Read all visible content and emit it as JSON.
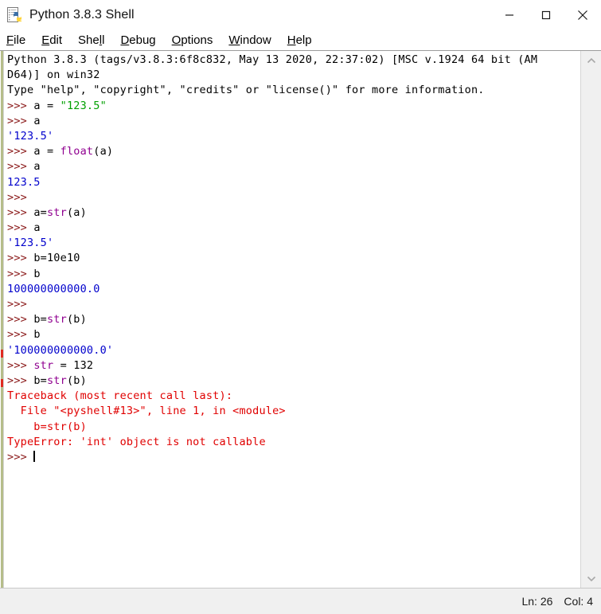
{
  "window": {
    "title": "Python 3.8.3 Shell",
    "icon": "python-idle-icon",
    "controls": {
      "minimize": "minimize-button",
      "maximize": "maximize-button",
      "close": "close-button"
    }
  },
  "menubar": {
    "items": [
      {
        "label": "File",
        "accel": "F"
      },
      {
        "label": "Edit",
        "accel": "E"
      },
      {
        "label": "Shell",
        "accel": "l"
      },
      {
        "label": "Debug",
        "accel": "D"
      },
      {
        "label": "Options",
        "accel": "O"
      },
      {
        "label": "Window",
        "accel": "W"
      },
      {
        "label": "Help",
        "accel": "H"
      }
    ]
  },
  "shell": {
    "lines": [
      {
        "type": "banner",
        "text": "Python 3.8.3 (tags/v3.8.3:6f8c832, May 13 2020, 22:37:02) [MSC v.1924 64 bit (AM"
      },
      {
        "type": "banner",
        "text": "D64)] on win32"
      },
      {
        "type": "banner",
        "text": "Type \"help\", \"copyright\", \"credits\" or \"license()\" for more information."
      },
      {
        "type": "input",
        "prompt": ">>> ",
        "code": "a = ",
        "string": "\"123.5\""
      },
      {
        "type": "input",
        "prompt": ">>> ",
        "code": "a"
      },
      {
        "type": "output",
        "text": "'123.5'"
      },
      {
        "type": "input",
        "prompt": ">>> ",
        "code": "a = ",
        "builtin": "float",
        "code2": "(a)"
      },
      {
        "type": "input",
        "prompt": ">>> ",
        "code": "a"
      },
      {
        "type": "output",
        "text": "123.5"
      },
      {
        "type": "input",
        "prompt": ">>> "
      },
      {
        "type": "input",
        "prompt": ">>> ",
        "code": "a=",
        "builtin": "str",
        "code2": "(a)"
      },
      {
        "type": "input",
        "prompt": ">>> ",
        "code": "a"
      },
      {
        "type": "output",
        "text": "'123.5'"
      },
      {
        "type": "input",
        "prompt": ">>> ",
        "code": "b=10e10"
      },
      {
        "type": "input",
        "prompt": ">>> ",
        "code": "b"
      },
      {
        "type": "output",
        "text": "100000000000.0"
      },
      {
        "type": "input",
        "prompt": ">>> "
      },
      {
        "type": "input",
        "prompt": ">>> ",
        "code": "b=",
        "builtin": "str",
        "code2": "(b)"
      },
      {
        "type": "input",
        "prompt": ">>> ",
        "code": "b"
      },
      {
        "type": "output",
        "text": "'100000000000.0'"
      },
      {
        "type": "input",
        "prompt": ">>> ",
        "builtin": "str",
        "code2": " = 132"
      },
      {
        "type": "input",
        "prompt": ">>> ",
        "code": "b=",
        "builtin": "str",
        "code2": "(b)"
      },
      {
        "type": "error",
        "text": "Traceback (most recent call last):"
      },
      {
        "type": "error",
        "text": "  File \"<pyshell#13>\", line 1, in <module>"
      },
      {
        "type": "error",
        "text": "    b=str(b)"
      },
      {
        "type": "error",
        "text": "TypeError: 'int' object is not callable"
      },
      {
        "type": "input",
        "prompt": ">>> ",
        "caret": true
      }
    ],
    "scrollbar": {
      "up_arrow": "scroll-up-arrow",
      "down_arrow": "scroll-down-arrow"
    }
  },
  "statusbar": {
    "line": "Ln: 26",
    "col": "Col: 4"
  },
  "colors": {
    "prompt": "#8b1a1a",
    "string": "#00a000",
    "builtin": "#900090",
    "output": "#0000cc",
    "error": "#e00000",
    "text": "#000000"
  }
}
